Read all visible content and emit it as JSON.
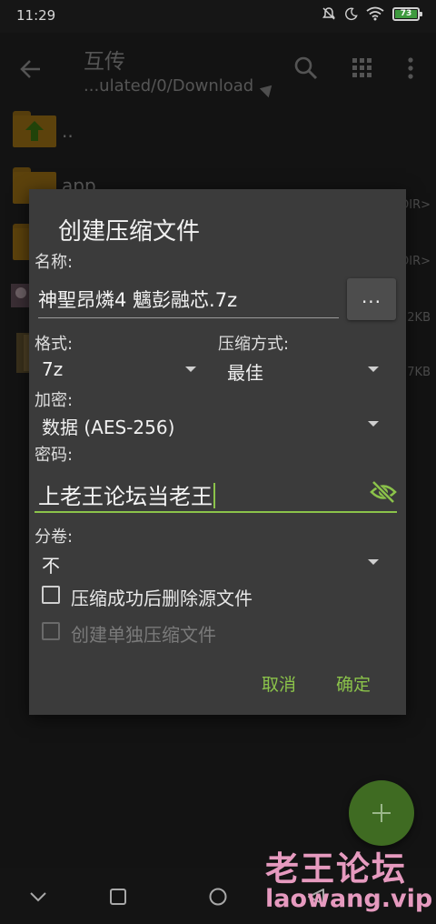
{
  "status_bar": {
    "time": "11:29",
    "battery": "73"
  },
  "app_bar": {
    "title": "互传",
    "path": "...ulated/0/Download"
  },
  "file_list": [
    {
      "name": "..",
      "meta": ""
    },
    {
      "name": "app",
      "meta": ""
    },
    {
      "name": "",
      "meta": "DIR>"
    },
    {
      "name": "",
      "meta": "DIR>"
    },
    {
      "name": "",
      "meta": "2KB"
    },
    {
      "name": "",
      "meta": "7KB"
    }
  ],
  "dialog": {
    "title": "创建压缩文件",
    "name_label": "名称:",
    "name_value": "神聖昂燐4 魑彭融芯.7z",
    "browse_label": "...",
    "format_label": "格式:",
    "format_value": "7z",
    "compression_label": "压缩方式:",
    "compression_value": "最佳",
    "encryption_label": "加密:",
    "encryption_value": "数据 (AES-256)",
    "password_label": "密码:",
    "password_value": "上老王论坛当老王",
    "volume_label": "分卷:",
    "volume_value": "不",
    "delete_source_label": "压缩成功后删除源文件",
    "separate_archives_label": "创建单独压缩文件",
    "cancel_label": "取消",
    "ok_label": "确定"
  },
  "watermark": {
    "cn": "老王论坛",
    "en": "laowang.vip"
  },
  "colors": {
    "accent": "#8bc34a",
    "dialog_bg": "#3b3b3b",
    "background": "#232323",
    "folder": "#a87817",
    "watermark": "#e69abf"
  }
}
